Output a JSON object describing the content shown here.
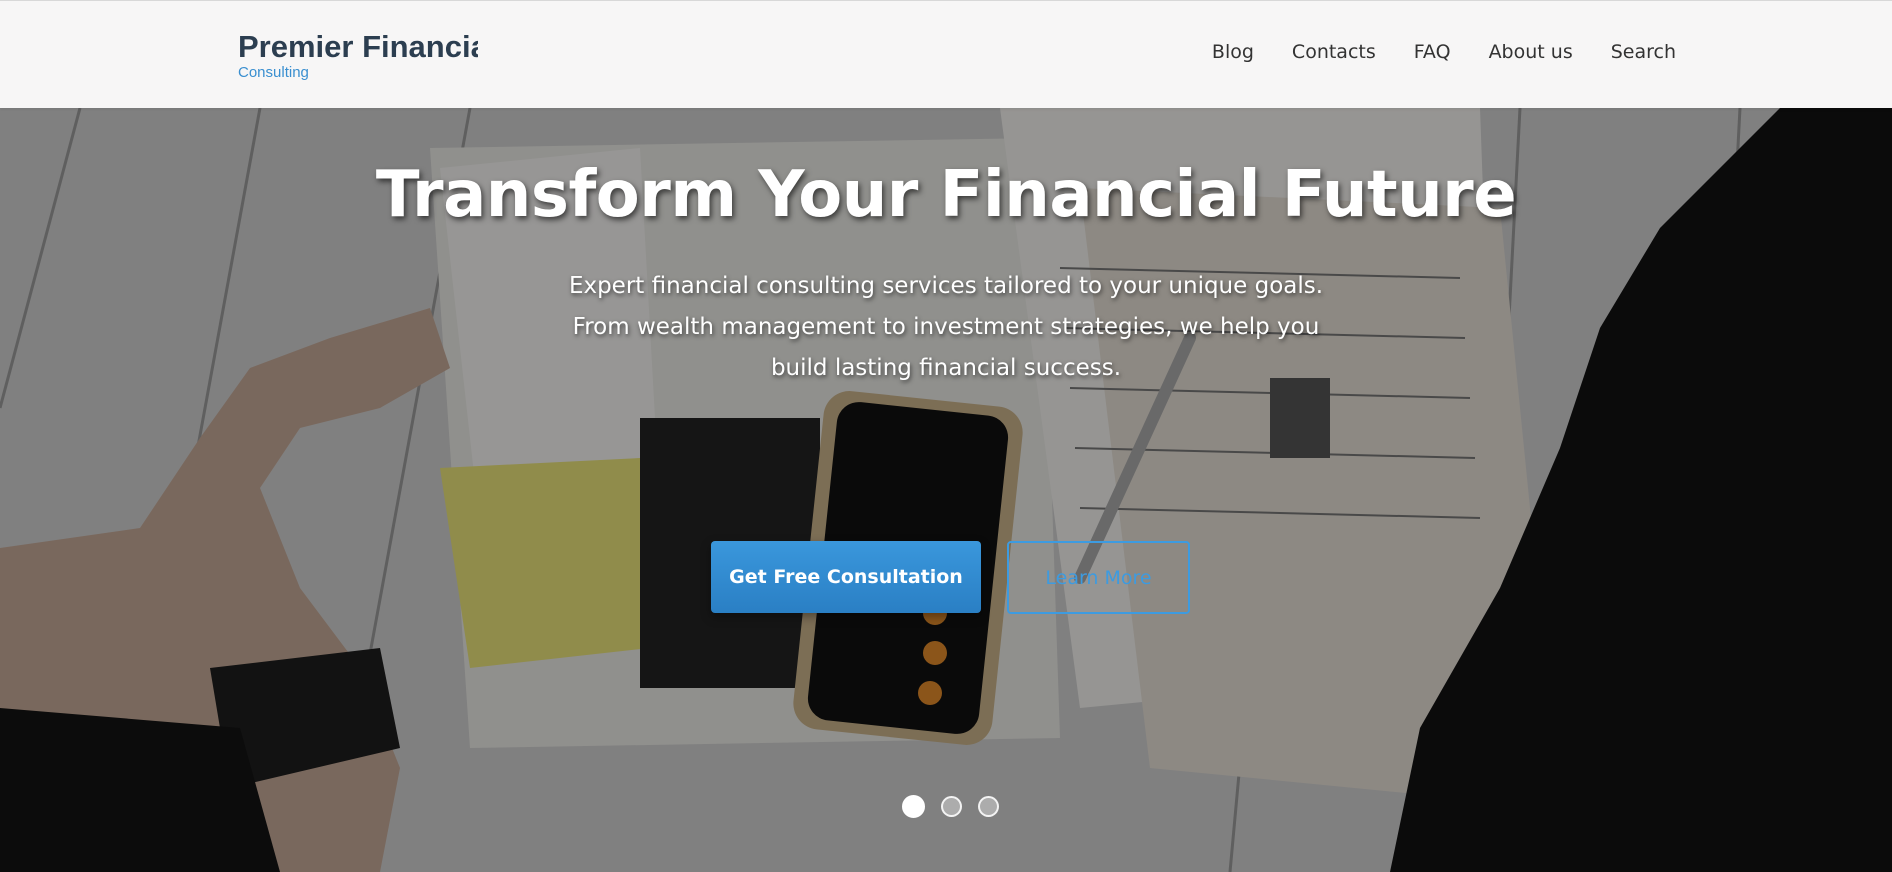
{
  "brand": {
    "name": "Premier Financial",
    "tagline": "Consulting"
  },
  "nav": {
    "items": [
      {
        "label": "Blog"
      },
      {
        "label": "Contacts"
      },
      {
        "label": "FAQ"
      },
      {
        "label": "About us"
      },
      {
        "label": "Search"
      }
    ]
  },
  "hero": {
    "title": "Transform Your Financial Future",
    "subtitle": "Expert financial consulting services tailored to your unique goals. From wealth management to investment strategies, we help you build lasting financial success.",
    "primary_cta": "Get Free Consultation",
    "secondary_cta": "Learn More",
    "slides_total": 3,
    "active_slide": 1
  },
  "colors": {
    "accent": "#2a88d0",
    "brand_text": "#2c3e50",
    "header_bg": "#f7f6f6"
  }
}
